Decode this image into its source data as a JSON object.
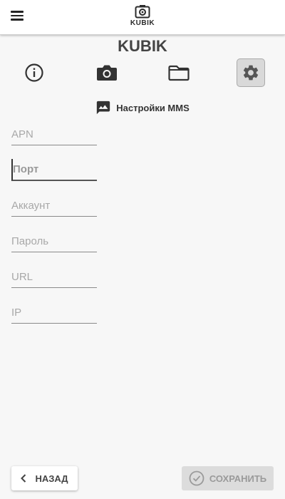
{
  "header": {
    "logo_text": "KUBIK",
    "menu_icon": "hamburger-menu-icon",
    "logo_icon": "camera-logo-icon"
  },
  "app_title": "KUBIK",
  "tabs": [
    {
      "id": "info",
      "icon": "info-icon",
      "active": false
    },
    {
      "id": "camera",
      "icon": "camera-icon",
      "active": false
    },
    {
      "id": "folder",
      "icon": "folder-icon",
      "active": false
    },
    {
      "id": "settings",
      "icon": "gear-icon",
      "active": true
    }
  ],
  "section": {
    "icon": "mms-message-icon",
    "title": "Настройки MMS"
  },
  "form": {
    "fields": [
      {
        "key": "apn",
        "placeholder": "APN",
        "value": ""
      },
      {
        "key": "port",
        "placeholder": "Порт",
        "value": "",
        "focused": true
      },
      {
        "key": "account",
        "placeholder": "Аккаунт",
        "value": ""
      },
      {
        "key": "password",
        "placeholder": "Пароль",
        "value": ""
      },
      {
        "key": "url",
        "placeholder": "URL",
        "value": ""
      },
      {
        "key": "ip",
        "placeholder": "IP",
        "value": ""
      }
    ]
  },
  "footer": {
    "back_label": "НАЗАД",
    "back_icon": "chevron-left-icon",
    "save_label": "СОХРАНИТЬ",
    "save_icon": "check-circle-icon",
    "save_disabled": true
  },
  "colors": {
    "background": "#f7f7f7",
    "active_tab": "#d9d9d9",
    "save_button": "#dcdcdc"
  }
}
